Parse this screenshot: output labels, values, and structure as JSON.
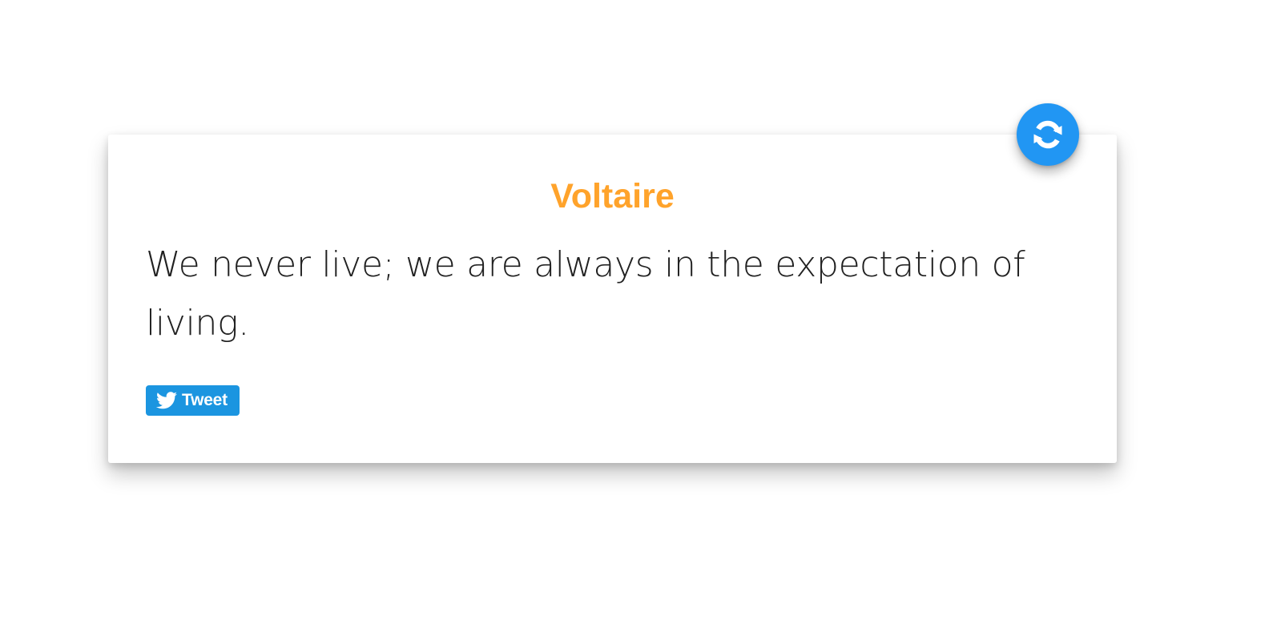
{
  "quote": {
    "author": "Voltaire",
    "text": "We never live; we are always in the expectation of living."
  },
  "tweet": {
    "label": "Tweet",
    "icon": "twitter-bird-icon"
  },
  "refresh": {
    "icon": "refresh-icon"
  },
  "colors": {
    "author": "#FFA32B",
    "tweet_bg": "#1B95E0",
    "refresh_bg": "#2196F3",
    "text": "#212121"
  }
}
